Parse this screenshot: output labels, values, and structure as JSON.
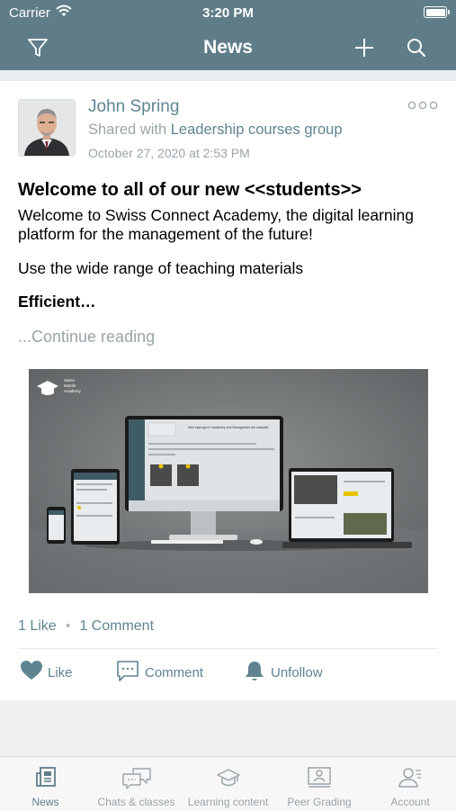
{
  "status": {
    "carrier": "Carrier",
    "time": "3:20 PM"
  },
  "nav": {
    "title": "News"
  },
  "post": {
    "author": "John Spring",
    "shared_prefix": "Shared with",
    "shared_group": "Leadership courses group",
    "date": "October 27, 2020 at 2:53 PM",
    "title": "Welcome to all of our new <<students>>",
    "paragraph1": "Welcome to Swiss Connect Academy, the digital learning platform for the management of the future!",
    "paragraph2": "Use the wide range of teaching materials",
    "paragraph3": "Efficient…",
    "continue": "...Continue reading",
    "image_brand": [
      "Swiss",
      "Mobile",
      "Academy"
    ],
    "screen_heading": "New trainings in Leadership and Management are available",
    "likes": "1 Like",
    "comments": "1 Comment",
    "actions": {
      "like": "Like",
      "comment": "Comment",
      "unfollow": "Unfollow"
    }
  },
  "tabs": [
    {
      "label": "News",
      "icon": "news-icon",
      "active": true
    },
    {
      "label": "Chats & classes",
      "icon": "chat-icon",
      "active": false
    },
    {
      "label": "Learning content",
      "icon": "graduation-cap-icon",
      "active": false
    },
    {
      "label": "Peer Grading",
      "icon": "presentation-icon",
      "active": false
    },
    {
      "label": "Account",
      "icon": "account-icon",
      "active": false
    }
  ],
  "colors": {
    "header": "#5f7d89",
    "accent": "#5f8491",
    "muted": "#9aa4a9"
  }
}
